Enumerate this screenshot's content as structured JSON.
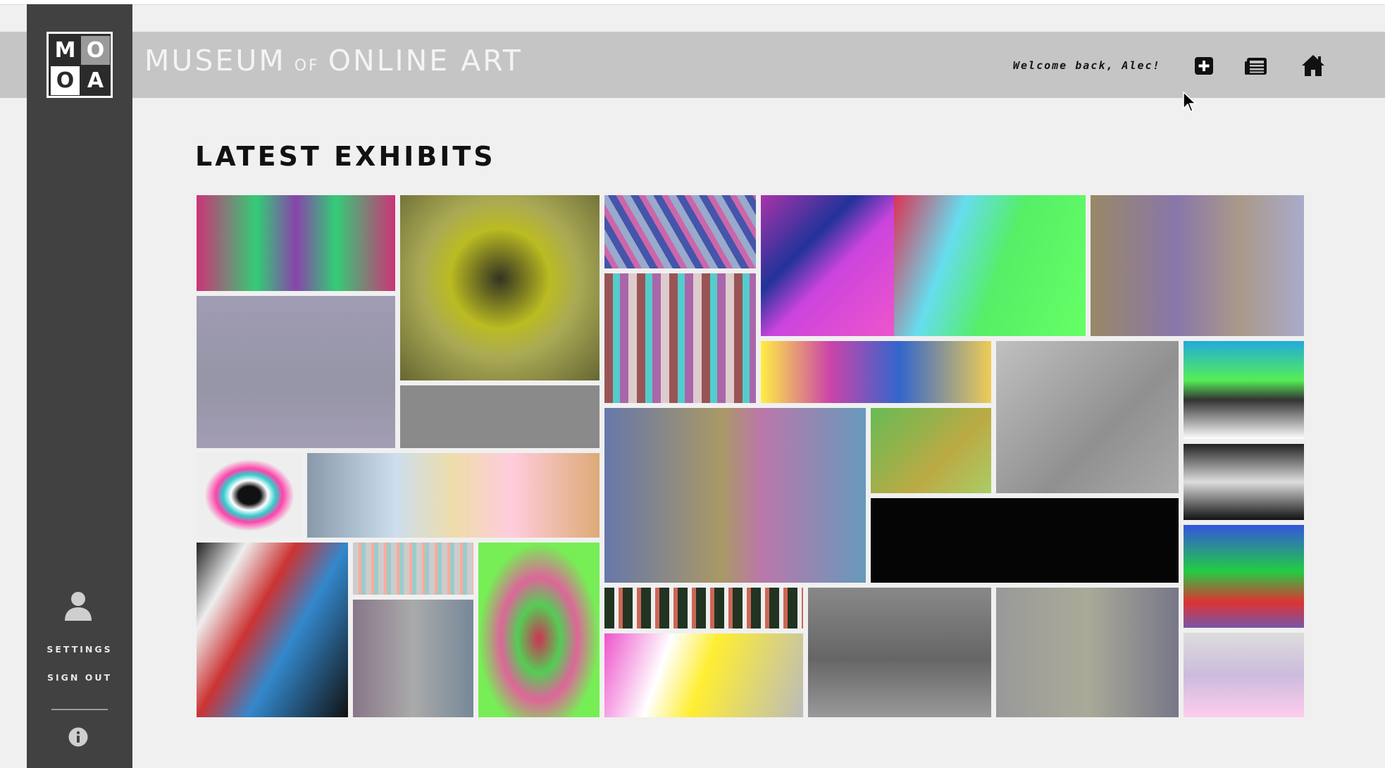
{
  "logo": {
    "letters": [
      "M",
      "O",
      "O",
      "A"
    ]
  },
  "header": {
    "title_word1": "MUSEUM",
    "title_of": "OF",
    "title_word2": "ONLINE ART",
    "welcome": "Welcome back, Alec!",
    "icons": [
      "add-icon",
      "newspaper-icon",
      "home-icon"
    ]
  },
  "main": {
    "heading": "LATEST EXHIBITS"
  },
  "sidebar": {
    "user_icon": "user-icon",
    "settings": "SETTINGS",
    "sign_out": "SIGN OUT",
    "info_icon": "info-icon"
  },
  "colors": {
    "sidebar": "#414141",
    "header": "#c5c5c5",
    "background": "#f0f0f0"
  },
  "exhibits": [
    {
      "art": "linear-gradient(90deg,#cc3377,#33cc77 30%,#8844aa 50%,#33cc77 70%,#cc3377)"
    },
    {
      "art": "radial-gradient(circle at 50% 45%,#333322 0%,#bbbb22 35%,#aaaa55 55%,#666633 100%)"
    },
    {
      "art": "repeating-linear-gradient(60deg,#4455aa 0 10px,#cc66aa 10px 18px,#99aacc 18px 28px)"
    },
    {
      "art": "linear-gradient(135deg,#aa33aa 0%,#223399 35%,#cc44dd 55%,#ee55cc 100%)"
    },
    {
      "art": "linear-gradient(110deg,#dd3355 0%,#66ddee 30%,#55ee66 55%,#66ff66 100%)"
    },
    {
      "art": "linear-gradient(90deg,#998866,#8877aa 40%,#aa9988 70%,#aaaacc)"
    },
    {
      "art": "linear-gradient(180deg,#a09cb4,#9595a6 60%,#a59db5)"
    },
    {
      "art": "repeating-linear-gradient(90deg,#995555 0 12px,#55cccc 12px 22px,#aa66aa 22px 34px,#ddcccc 34px 46px)"
    },
    {
      "art": "#8a8a8a"
    },
    {
      "art": "linear-gradient(90deg,#ffee44,#cc44aa 30%,#3366cc 60%,#eecc55)"
    },
    {
      "art": "linear-gradient(135deg,#c0c0c0,#909090 60%,#aaaaaa)"
    },
    {
      "art": "linear-gradient(180deg,#22aadd,#55ee55 40%,#333333 60%,#ffffff)"
    },
    {
      "art": "linear-gradient(90deg,#6677aa,#aa9966 45%,#bb77aa 60%,#6699bb)"
    },
    {
      "art": "linear-gradient(135deg,#66bb55,#bbaa44 60%,#aacc66)"
    },
    {
      "art": "radial-gradient(ellipse at 50% 50%,#111111 0 15%,#ffffff 25%,#33cccc 35%,#ff44aa 45%,#eeeeee 60%)"
    },
    {
      "art": "linear-gradient(90deg,#8899aa,#ccddee 30%,#eeddaa 50%,#ffccdd 70%,#ddaa77)"
    },
    {
      "art": "#050505"
    },
    {
      "art": "linear-gradient(180deg,#222222,#dddddd 50%,#111111)"
    },
    {
      "art": "linear-gradient(120deg,#222222,#eeeeee 20%,#cc3333 40%,#3388cc 60%,#111111)"
    },
    {
      "art": "repeating-linear-gradient(90deg,#cccccc 0 8px,#ffaa99 8px 12px,#99cccc 12px 18px)"
    },
    {
      "art": "linear-gradient(180deg,#3355dd,#22cc44 45%,#dd3333 75%,#7755aa)"
    },
    {
      "art": "linear-gradient(90deg,#887788,#aaaaaa 50%,#778899)"
    },
    {
      "art": "radial-gradient(ellipse at 50% 55%,#cc3355 0%,#55cc55 25%,#dd6699 45%,#77ee55 70%)"
    },
    {
      "art": "repeating-linear-gradient(90deg,#223322 0 14px,#eeeeee 14px 20px,#cc6655 20px 26px)"
    },
    {
      "art": "linear-gradient(180deg,#888888,#666666 55%,#999999)"
    },
    {
      "art": "linear-gradient(90deg,#999999,#aaaa99 50%,#777788)"
    },
    {
      "art": "linear-gradient(180deg,#dddddd,#ccbbdd 50%,#ffccee)"
    },
    {
      "art": "linear-gradient(110deg,#ee55cc,#ffffff 30%,#ffee33 50%,#bbbbbb)"
    }
  ]
}
